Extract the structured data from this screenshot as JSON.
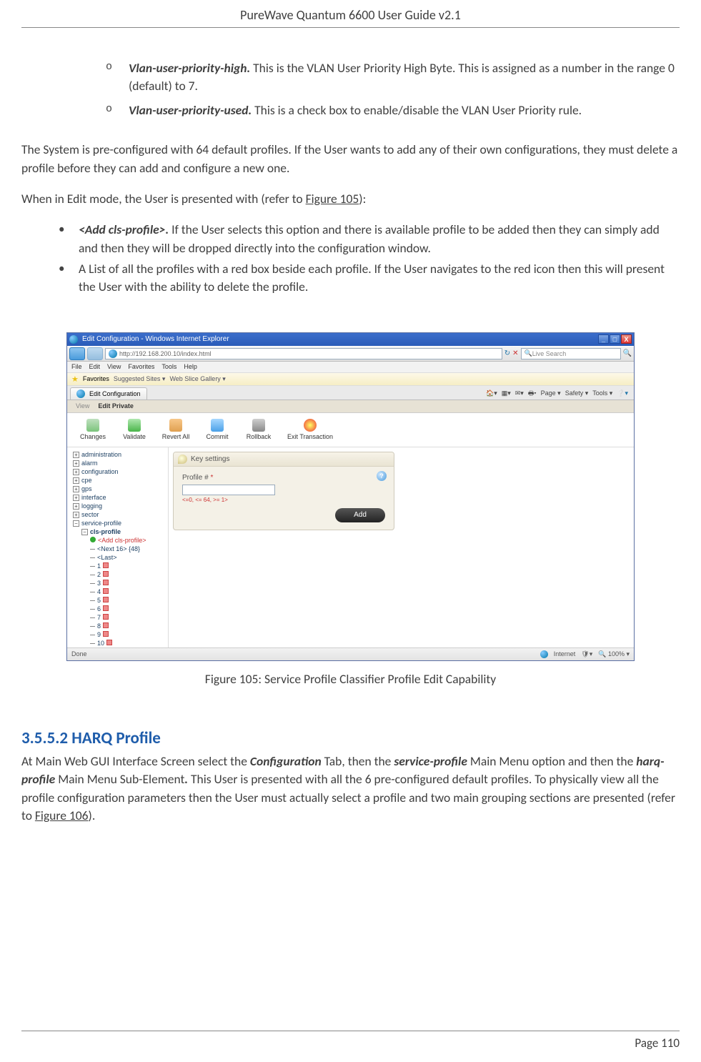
{
  "header": {
    "title": "PureWave Quantum 6600 User Guide v2.1"
  },
  "sublist": [
    {
      "term": "Vlan-user-priority-high.",
      "text": " This is the VLAN User Priority High Byte. This is assigned as a number in the range 0 (default) to 7."
    },
    {
      "term": "Vlan-user-priority-used.",
      "text": " This is a check box to enable/disable the VLAN User Priority rule."
    }
  ],
  "para1": "The System is pre-configured with 64 default profiles. If the User wants to add any of their own configurations, they must delete a profile before they can add and configure a new one.",
  "para2_pre": "When in Edit mode, the User is presented with (refer to ",
  "para2_link": "Figure 105",
  "para2_post": "):",
  "mainlist": [
    {
      "term": "<Add cls-profile>.",
      "text": " If the User selects this option and there is available profile to be added then they can simply add and then they will be dropped directly into the configuration window."
    },
    {
      "term": "",
      "text": "A List of all the profiles with a red box beside each profile. If the User navigates to the red icon then this will present the User with the ability to delete the profile."
    }
  ],
  "screenshot": {
    "title": "Edit Configuration - Windows Internet Explorer",
    "address": "http://192.168.200.10/index.html",
    "search_placeholder": "Live Search",
    "menus": [
      "File",
      "Edit",
      "View",
      "Favorites",
      "Tools",
      "Help"
    ],
    "favorites_label": "Favorites",
    "fav_links": [
      "Suggested Sites ▾",
      "Web Slice Gallery ▾"
    ],
    "tab_label": "Edit Configuration",
    "tool_row": [
      "Page ▾",
      "Safety ▾",
      "Tools ▾"
    ],
    "view_tabs": [
      "View",
      "Edit Private"
    ],
    "toolbar_buttons": [
      "Changes",
      "Validate",
      "Revert All",
      "Commit",
      "Rollback",
      "Exit Transaction"
    ],
    "tree": {
      "roots": [
        "administration",
        "alarm",
        "configuration",
        "cpe",
        "gps",
        "interface",
        "logging",
        "sector",
        "service-profile"
      ],
      "service_children": {
        "label": "cls-profile",
        "actions": [
          "<Add cls-profile>",
          "<Next 16> {48}",
          "<Last>"
        ],
        "items": [
          "1",
          "2",
          "3",
          "4",
          "5",
          "6",
          "7",
          "8",
          "9",
          "10"
        ]
      }
    },
    "panel": {
      "header": "Key settings",
      "field_label": "Profile #",
      "hint": "<=0, <= 64, >= 1>",
      "add_button": "Add"
    },
    "status_left": "Done",
    "status_internet": "Internet",
    "status_zoom": "100%"
  },
  "figure_caption": "Figure 105: Service Profile Classifier Profile Edit Capability",
  "section": {
    "number": "3.5.5.2",
    "title": "HARQ Profile",
    "body_pre": "At Main Web GUI Interface Screen select the ",
    "b1": "Configuration",
    "body_mid1": " Tab, then the ",
    "b2": "service-profile",
    "body_mid2": " Main Menu option and then the ",
    "b3": "harq-profile",
    "body_mid3": " Main Menu Sub-Element",
    "b4": ".",
    "body_tail": " This User is presented with all the 6 pre-configured default profiles. To physically view all the profile configuration parameters then the User must actually select a profile and two main grouping sections are presented (refer to ",
    "body_link": "Figure 106",
    "body_end": ")."
  },
  "footer": {
    "page": "Page 110"
  }
}
